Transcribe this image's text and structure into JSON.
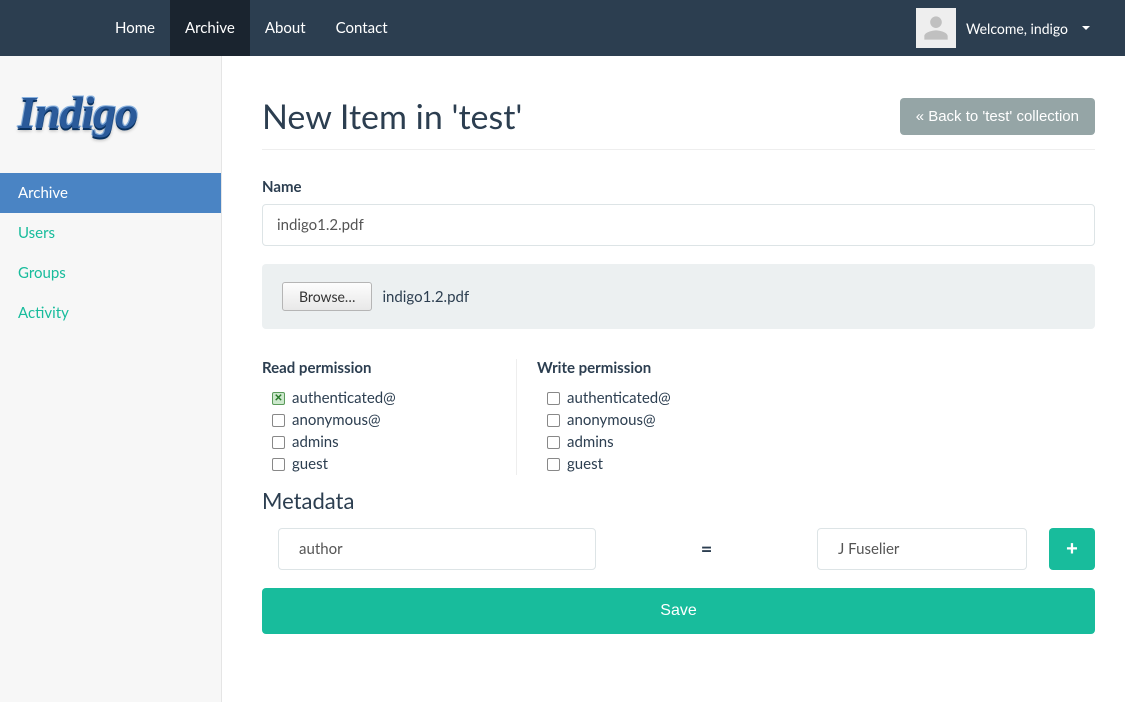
{
  "nav": {
    "items": [
      {
        "label": "Home",
        "active": false
      },
      {
        "label": "Archive",
        "active": true
      },
      {
        "label": "About",
        "active": false
      },
      {
        "label": "Contact",
        "active": false
      }
    ],
    "welcome_prefix": "Welcome, ",
    "username": "indigo"
  },
  "brand": "Indigo",
  "sidebar": {
    "items": [
      {
        "label": "Archive",
        "active": true
      },
      {
        "label": "Users",
        "active": false
      },
      {
        "label": "Groups",
        "active": false
      },
      {
        "label": "Activity",
        "active": false
      }
    ]
  },
  "page": {
    "title": "New Item in 'test'",
    "back_label": "« Back to 'test' collection"
  },
  "form": {
    "name_label": "Name",
    "name_value": "indigo1.2.pdf",
    "browse_label": "Browse…",
    "file_selected": "indigo1.2.pdf"
  },
  "permissions": {
    "read_label": "Read permission",
    "write_label": "Write permission",
    "read": [
      {
        "label": "authenticated@",
        "checked": true
      },
      {
        "label": "anonymous@",
        "checked": false
      },
      {
        "label": "admins",
        "checked": false
      },
      {
        "label": "guest",
        "checked": false
      }
    ],
    "write": [
      {
        "label": "authenticated@",
        "checked": false
      },
      {
        "label": "anonymous@",
        "checked": false
      },
      {
        "label": "admins",
        "checked": false
      },
      {
        "label": "guest",
        "checked": false
      }
    ]
  },
  "metadata": {
    "heading": "Metadata",
    "rows": [
      {
        "key": "author",
        "value": "J Fuselier"
      }
    ],
    "add_icon": "+",
    "equals": "="
  },
  "actions": {
    "save_label": "Save"
  },
  "colors": {
    "navbar": "#2c3e50",
    "accent": "#18bc9c",
    "sidebar_active": "#4a84c4",
    "grey_btn": "#95a5a6"
  }
}
